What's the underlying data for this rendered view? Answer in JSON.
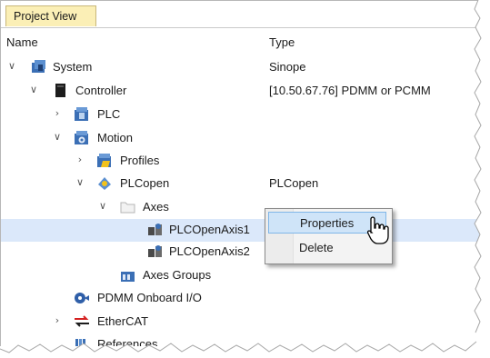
{
  "tab": {
    "label": "Project View"
  },
  "columns": {
    "name": "Name",
    "type": "Type"
  },
  "tree": {
    "system": {
      "label": "System",
      "type": "Sinope"
    },
    "controller": {
      "label": "Controller",
      "type": "[10.50.67.76] PDMM or PCMM"
    },
    "plc": {
      "label": "PLC"
    },
    "motion": {
      "label": "Motion"
    },
    "profiles": {
      "label": "Profiles"
    },
    "plcopen": {
      "label": "PLCopen",
      "type": "PLCopen"
    },
    "axes": {
      "label": "Axes"
    },
    "axis1": {
      "label": "PLCOpenAxis1"
    },
    "axis2": {
      "label": "PLCOpenAxis2"
    },
    "axes_groups": {
      "label": "Axes Groups"
    },
    "pdmm_io": {
      "label": "PDMM Onboard I/O"
    },
    "ethercat": {
      "label": "EtherCAT"
    },
    "references": {
      "label": "References"
    }
  },
  "context_menu": {
    "properties": "Properties",
    "delete": "Delete"
  },
  "colors": {
    "tab_bg": "#fbefb6",
    "selection": "#dbe8fa",
    "menu_highlight": "#cfe4f8"
  }
}
